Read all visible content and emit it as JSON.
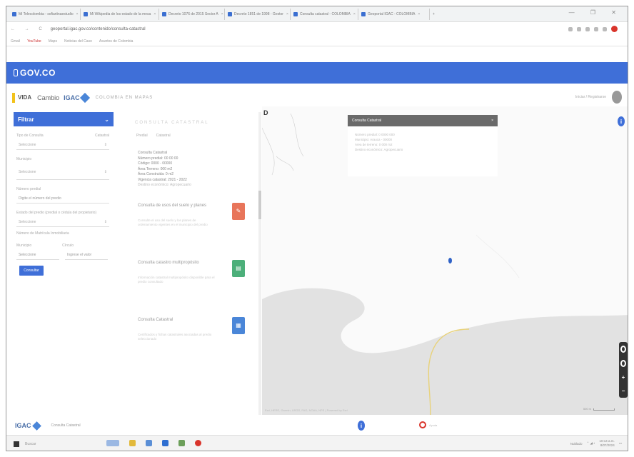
{
  "browser": {
    "tabs": [
      {
        "label": "Mi Telecolombia - sofiartinaestudio"
      },
      {
        "label": "Mi Wikipedia de los estado de la mesa"
      },
      {
        "label": "Decreto 1076 de 2015 Sector A"
      },
      {
        "label": "Decreto 1851 de 1998 - Gestor"
      },
      {
        "label": "Consulta catastral - COLOMBIA"
      },
      {
        "label": "Geoportal IGAC - COLOMBIA"
      }
    ],
    "window_controls": "— ❐ ✕",
    "nav_glyphs": "← → C",
    "url": "geoportal.igac.gov.co/contenido/consulta-catastral",
    "bookmarks": [
      "Gmail",
      "YouTube",
      "Maps",
      "Noticias del Caso",
      "Asuntos de Colombia"
    ]
  },
  "gov_bar": {
    "logo_text": "GOV.CO"
  },
  "header": {
    "logo_vida": "VIDA",
    "logo_cambio": "Cambio",
    "logo_igac": "IGAC",
    "app_title": "COLOMBIA EN MAPAS",
    "user_text": "Iniciar / Registrarse"
  },
  "filter": {
    "title": "Filtrar",
    "collapse_glyph": "⌄",
    "fields": [
      {
        "label": "Tipo de Consulta",
        "aux": "Catastral",
        "value": "Seleccione"
      },
      {
        "label": "Municipio",
        "value": "Seleccione"
      },
      {
        "label": "Número predial",
        "value": "Digite el número del predio"
      },
      {
        "label": "Estado del predio (predial o cédula del propietario)",
        "value": "Seleccione"
      }
    ],
    "note": "Número de Matrícula Inmobiliaria",
    "pair_labels": [
      "Municipio",
      "Círculo"
    ],
    "pair_values": [
      "Seleccione",
      "Ingrese el valor"
    ],
    "consult_button": "Consultar"
  },
  "results": {
    "title": "CONSULTA CATASTRAL",
    "tabs": [
      "Predial",
      "Catastral"
    ],
    "info_lines": [
      "Consulta Catastral",
      "Número predial: 00 00 00",
      "Código: 0000 - 00000",
      "Área Terreno: 000 m2",
      "Área Construida: 0 m2",
      "Vigencia catastral: 2021 - 2022",
      "Destino económico: Agropecuario"
    ],
    "cards": [
      {
        "title": "Consulta de usos del suelo y planes",
        "desc": "Consulte el uso del suelo y los planes de ordenamiento vigentes en el municipio del predio",
        "icon": "pencil-icon"
      },
      {
        "title": "Consulta catastro multipropósito",
        "desc": "Información catastral multipropósito disponible para el predio consultado",
        "icon": "document-icon"
      },
      {
        "title": "Consulta Catastral",
        "desc": "Certificados y fichas catastrales asociadas al predio seleccionado",
        "icon": "calculator-icon"
      }
    ]
  },
  "map": {
    "popup_title": "Consulta Catastral",
    "popup_close": "×",
    "popup_lines": [
      "Número predial: 0 0000 000",
      "Municipio: Arauca - 00000",
      "Área de terreno: 0 000 m2",
      "Destino económico: Agropecuario"
    ],
    "attribution": "Esri, HERE, Garmin, USGS, FAO, NOAA, NPS | Powered by Esri",
    "scale_label": "500 m"
  },
  "footer": {
    "logo": "IGAC",
    "label": "Consulta Catastral",
    "red_label": "Ayuda"
  },
  "taskbar": {
    "search": "Buscar",
    "weather": "Nublado",
    "time": "10:14 a.m.",
    "date": "8/07/2024"
  },
  "colors": {
    "brand_blue": "#3f6fd8",
    "map_land": "#e2e2e2",
    "road": "#e8d27a"
  }
}
